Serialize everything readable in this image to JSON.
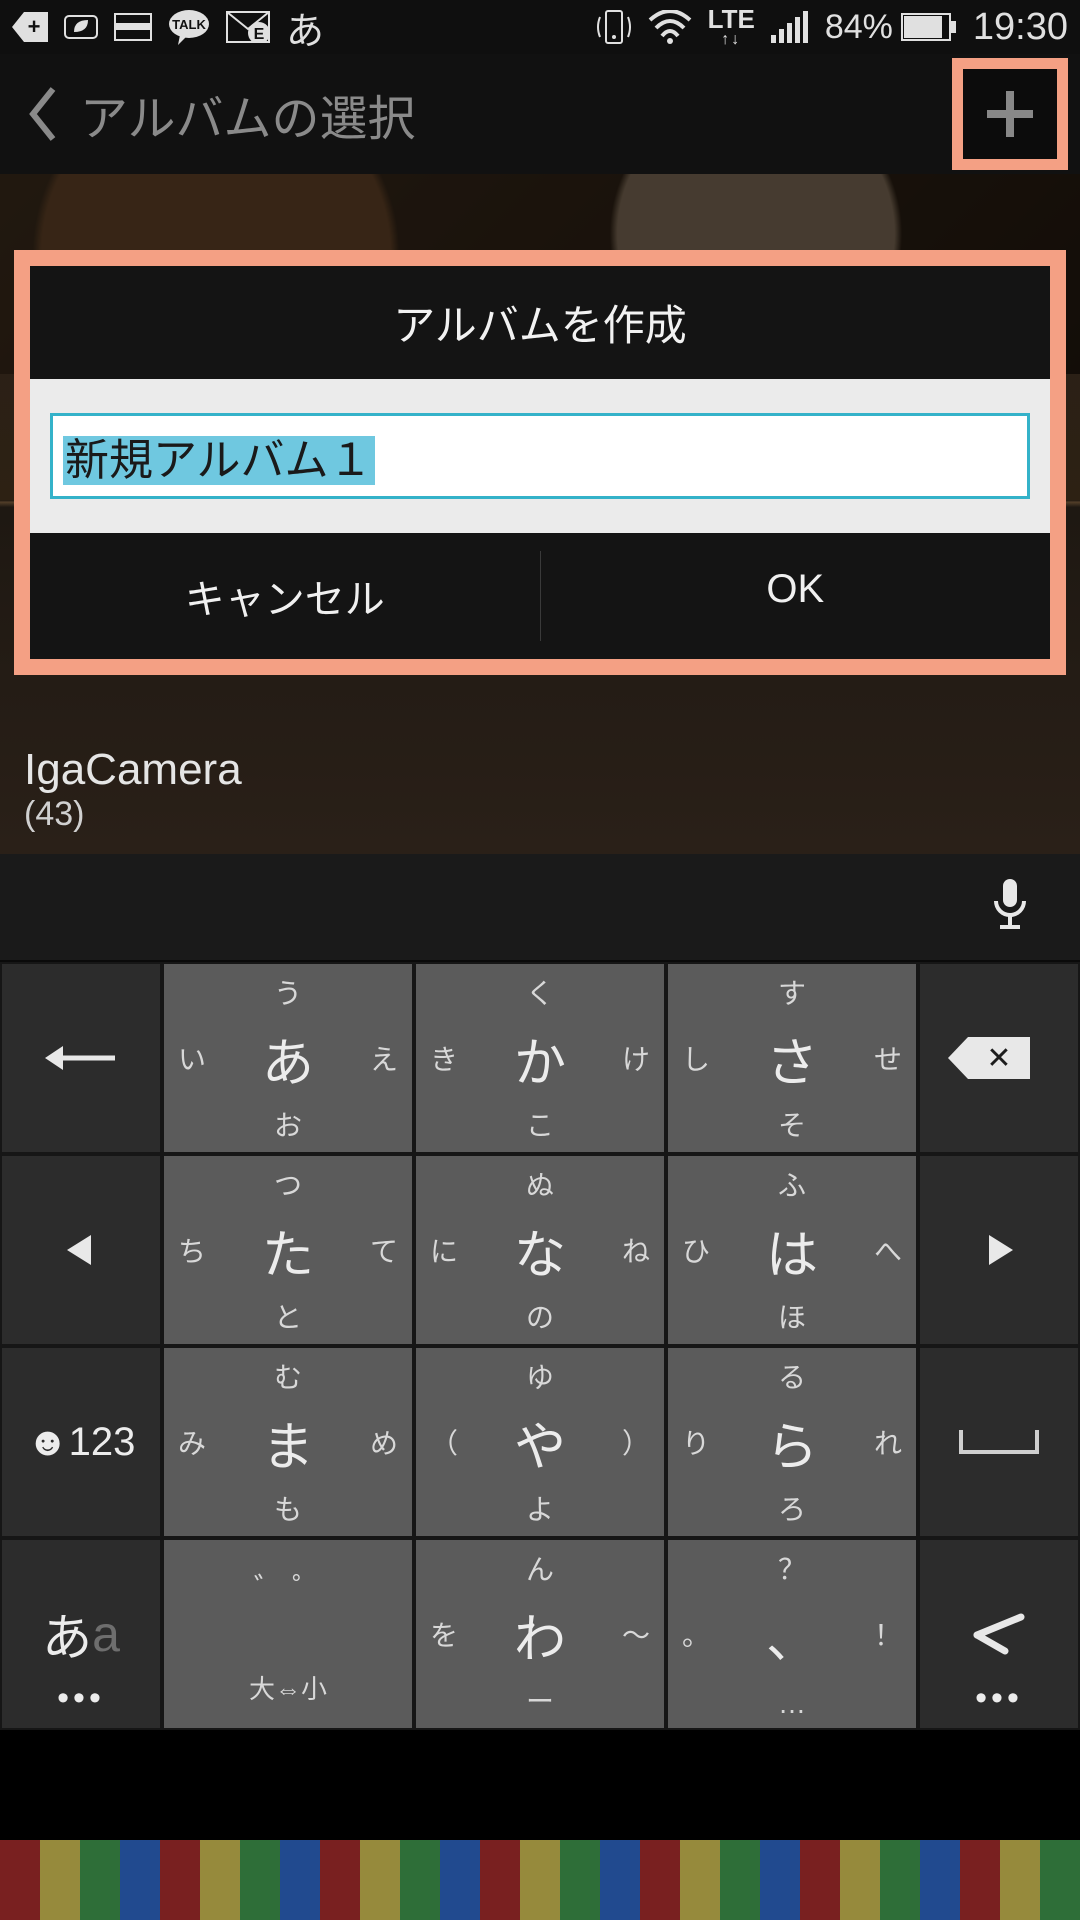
{
  "statusbar": {
    "ime": "あ",
    "network": "LTE",
    "battery_pct": "84%",
    "clock": "19:30"
  },
  "header": {
    "title": "アルバムの選択"
  },
  "album": {
    "name": "IgaCamera",
    "count": "(43)"
  },
  "dialog": {
    "title": "アルバムを作成",
    "input_value": "新規アルバム１",
    "cancel": "キャンセル",
    "ok": "OK"
  },
  "keyboard": {
    "row1": {
      "side_l": "",
      "k1": {
        "c": "あ",
        "t": "う",
        "b": "お",
        "l": "い",
        "r": "え"
      },
      "k2": {
        "c": "か",
        "t": "く",
        "b": "こ",
        "l": "き",
        "r": "け"
      },
      "k3": {
        "c": "さ",
        "t": "す",
        "b": "そ",
        "l": "し",
        "r": "せ"
      },
      "side_r": ""
    },
    "row2": {
      "side_l": "",
      "k1": {
        "c": "た",
        "t": "つ",
        "b": "と",
        "l": "ち",
        "r": "て"
      },
      "k2": {
        "c": "な",
        "t": "ぬ",
        "b": "の",
        "l": "に",
        "r": "ね"
      },
      "k3": {
        "c": "は",
        "t": "ふ",
        "b": "ほ",
        "l": "ひ",
        "r": "へ"
      },
      "side_r": ""
    },
    "row3": {
      "side_l": "☻123",
      "k1": {
        "c": "ま",
        "t": "む",
        "b": "も",
        "l": "み",
        "r": "め"
      },
      "k2": {
        "c": "や",
        "t": "ゆ",
        "b": "よ",
        "l": "（",
        "r": "）"
      },
      "k3": {
        "c": "ら",
        "t": "る",
        "b": "ろ",
        "l": "り",
        "r": "れ"
      },
      "side_r": ""
    },
    "row4": {
      "side_l_main": "あ",
      "side_l_ghost": "a",
      "k1": {
        "t": "゛  ゜",
        "b": "大⇔小"
      },
      "k2": {
        "c": "わ",
        "t": "ん",
        "b": "ー",
        "l": "を",
        "r": "～"
      },
      "k3": {
        "c": "、",
        "t": "？",
        "b": "…",
        "l": "。",
        "r": "！"
      },
      "side_r": ""
    }
  }
}
